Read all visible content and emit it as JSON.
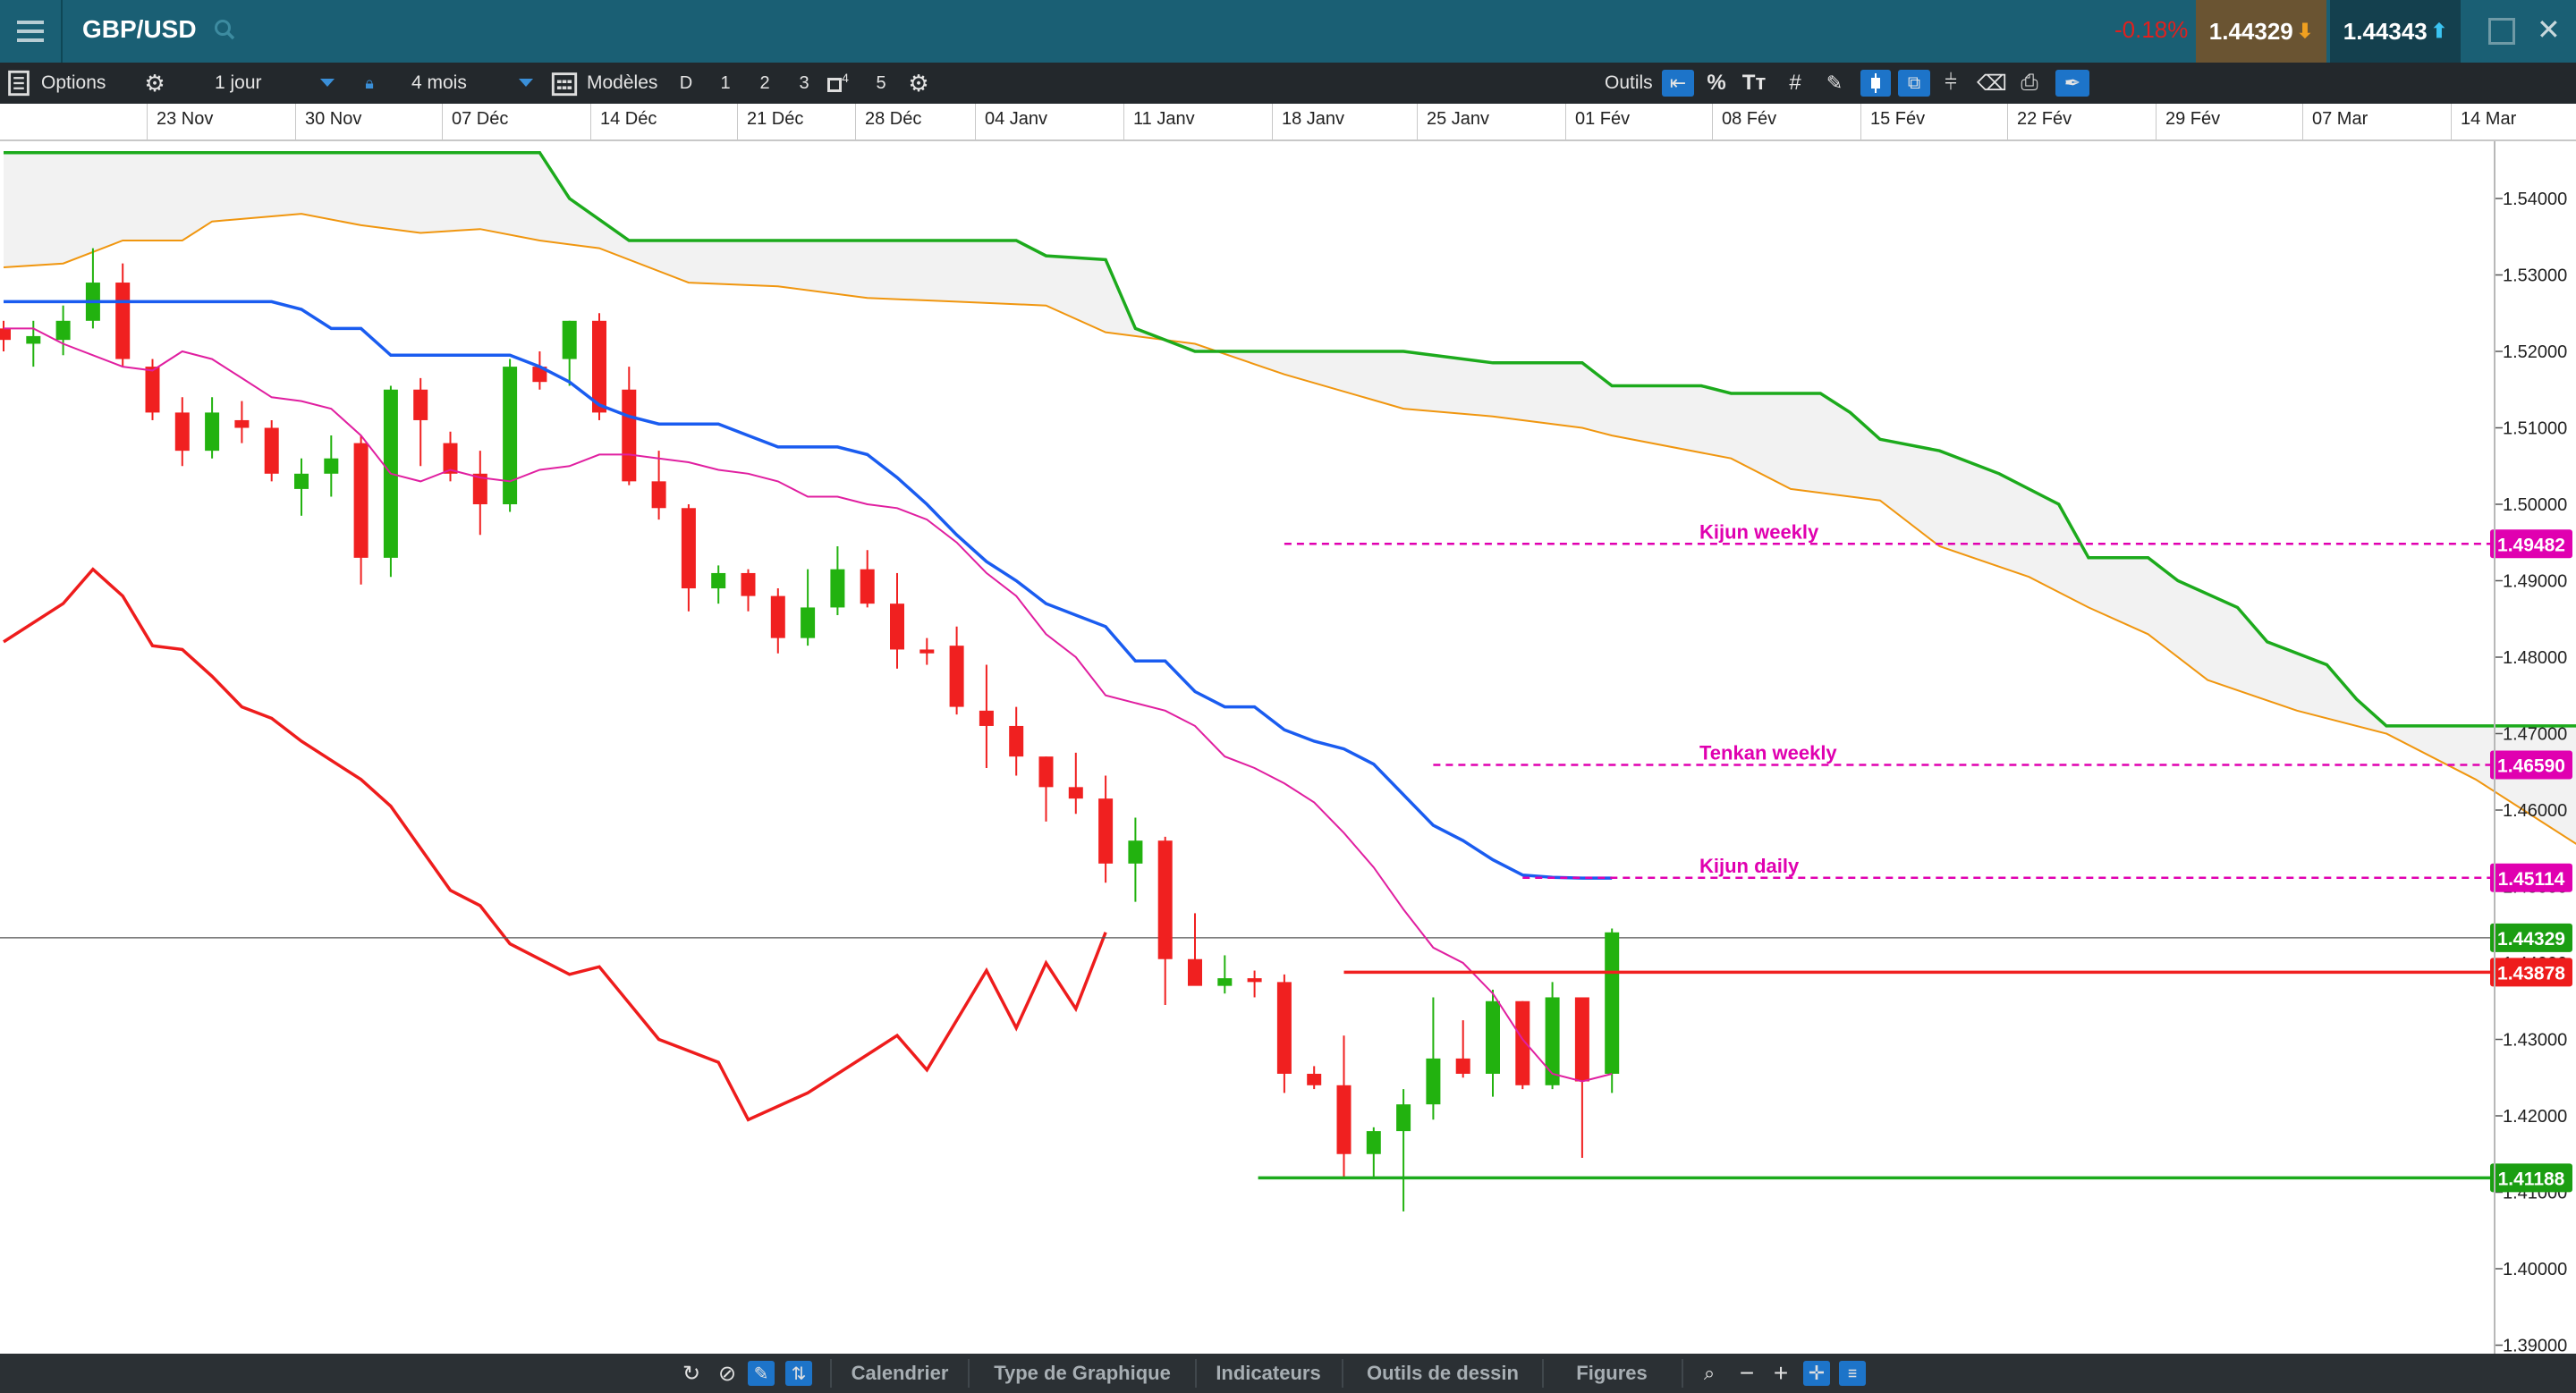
{
  "header": {
    "instrument": "GBP/USD",
    "change": "-0.18%",
    "bid": "1.44329",
    "ask": "1.44343"
  },
  "toolbar": {
    "options_label": "Options",
    "interval": "1 jour",
    "period": "4 mois",
    "models_label": "Modèles",
    "model_buttons": [
      "D",
      "1",
      "2",
      "3",
      "4",
      "5"
    ],
    "tools_label": "Outils"
  },
  "bottom_bar": {
    "tabs": [
      "Calendrier",
      "Type de Graphique",
      "Indicateurs",
      "Outils de dessin",
      "Figures"
    ]
  },
  "colors": {
    "header_bg": "#1a5f74",
    "toolbar_bg": "#23282c",
    "bullish": "#22b20f",
    "bearish": "#f02020",
    "kijun": "#1a5cf0",
    "tenkan": "#e01fa0",
    "senkou_b": "#1caa1c",
    "senkou_a": "#f0960f",
    "chikou": "#ee1c1c",
    "level_line": "#e000b0"
  },
  "chart_data": {
    "type": "candlestick",
    "x_axis_type": "date",
    "date_ticks": [
      "23 Nov",
      "30 Nov",
      "07 Déc",
      "14 Déc",
      "21 Déc",
      "28 Déc",
      "04 Janv",
      "11 Janv",
      "18 Janv",
      "25 Janv",
      "01 Fév",
      "08 Fév",
      "15 Fév",
      "22 Fév",
      "29 Fév",
      "07 Mar",
      "14 Mar"
    ],
    "price_ticks": [
      "1.54000",
      "1.53000",
      "1.52000",
      "1.51000",
      "1.50000",
      "1.49000",
      "1.48000",
      "1.47000",
      "1.46000",
      "1.45000",
      "1.44000",
      "1.43000",
      "1.42000",
      "1.41000",
      "1.40000",
      "1.39000"
    ],
    "ylim": [
      1.3895,
      1.5475
    ],
    "grid": false,
    "candles": [
      [
        1.523,
        1.524,
        1.52,
        1.5215
      ],
      [
        1.521,
        1.524,
        1.518,
        1.522
      ],
      [
        1.5215,
        1.526,
        1.5195,
        1.524
      ],
      [
        1.524,
        1.5335,
        1.523,
        1.529
      ],
      [
        1.529,
        1.5315,
        1.518,
        1.519
      ],
      [
        1.518,
        1.519,
        1.511,
        1.512
      ],
      [
        1.512,
        1.514,
        1.505,
        1.507
      ],
      [
        1.507,
        1.514,
        1.506,
        1.512
      ],
      [
        1.511,
        1.5135,
        1.508,
        1.51
      ],
      [
        1.51,
        1.511,
        1.503,
        1.504
      ],
      [
        1.502,
        1.506,
        1.4985,
        1.504
      ],
      [
        1.504,
        1.509,
        1.501,
        1.506
      ],
      [
        1.508,
        1.509,
        1.4895,
        1.493
      ],
      [
        1.493,
        1.5155,
        1.4905,
        1.515
      ],
      [
        1.515,
        1.5165,
        1.505,
        1.511
      ],
      [
        1.508,
        1.5095,
        1.503,
        1.504
      ],
      [
        1.504,
        1.507,
        1.496,
        1.5
      ],
      [
        1.5,
        1.519,
        1.499,
        1.518
      ],
      [
        1.518,
        1.52,
        1.515,
        1.516
      ],
      [
        1.519,
        1.524,
        1.5155,
        1.524
      ],
      [
        1.524,
        1.525,
        1.511,
        1.512
      ],
      [
        1.515,
        1.518,
        1.5025,
        1.503
      ],
      [
        1.503,
        1.507,
        1.498,
        1.4995
      ],
      [
        1.4995,
        1.5,
        1.486,
        1.489
      ],
      [
        1.489,
        1.492,
        1.487,
        1.491
      ],
      [
        1.491,
        1.4915,
        1.486,
        1.488
      ],
      [
        1.488,
        1.489,
        1.4805,
        1.4825
      ],
      [
        1.4825,
        1.4915,
        1.4815,
        1.4865
      ],
      [
        1.4865,
        1.4945,
        1.4855,
        1.4915
      ],
      [
        1.4915,
        1.494,
        1.4865,
        1.487
      ],
      [
        1.487,
        1.491,
        1.4785,
        1.481
      ],
      [
        1.481,
        1.4825,
        1.479,
        1.4805
      ],
      [
        1.4815,
        1.484,
        1.4725,
        1.4735
      ],
      [
        1.473,
        1.479,
        1.4655,
        1.471
      ],
      [
        1.471,
        1.4735,
        1.4645,
        1.467
      ],
      [
        1.467,
        1.467,
        1.4585,
        1.463
      ],
      [
        1.463,
        1.4675,
        1.4595,
        1.4615
      ],
      [
        1.4615,
        1.4645,
        1.4505,
        1.453
      ],
      [
        1.453,
        1.459,
        1.448,
        1.456
      ],
      [
        1.456,
        1.4565,
        1.4345,
        1.4405
      ],
      [
        1.4405,
        1.4465,
        1.4385,
        1.437
      ],
      [
        1.437,
        1.441,
        1.436,
        1.438
      ],
      [
        1.438,
        1.439,
        1.4355,
        1.4375
      ],
      [
        1.4375,
        1.4385,
        1.423,
        1.4255
      ],
      [
        1.4255,
        1.4265,
        1.4235,
        1.424
      ],
      [
        1.424,
        1.4305,
        1.412,
        1.415
      ],
      [
        1.415,
        1.4185,
        1.412,
        1.418
      ],
      [
        1.418,
        1.4235,
        1.4075,
        1.4215
      ],
      [
        1.4215,
        1.4355,
        1.4195,
        1.4275
      ],
      [
        1.4275,
        1.4325,
        1.425,
        1.4255
      ],
      [
        1.4255,
        1.4365,
        1.4225,
        1.435
      ],
      [
        1.435,
        1.435,
        1.4235,
        1.424
      ],
      [
        1.424,
        1.4375,
        1.4235,
        1.4355
      ],
      [
        1.4355,
        1.4345,
        1.4145,
        1.4245
      ],
      [
        1.4255,
        1.4445,
        1.423,
        1.444
      ]
    ],
    "kijun_daily": [
      1.5265,
      1.5265,
      1.5265,
      1.5265,
      1.5265,
      1.5265,
      1.5265,
      1.5265,
      1.5265,
      1.5265,
      1.5255,
      1.523,
      1.523,
      1.5195,
      1.5195,
      1.5195,
      1.5195,
      1.5195,
      1.518,
      1.516,
      1.513,
      1.5115,
      1.5105,
      1.5105,
      1.5105,
      1.509,
      1.5075,
      1.5075,
      1.5075,
      1.5065,
      1.5035,
      1.5,
      1.496,
      1.4925,
      1.49,
      1.487,
      1.4855,
      1.484,
      1.4795,
      1.4795,
      1.4755,
      1.4735,
      1.4735,
      1.4705,
      1.469,
      1.468,
      1.466,
      1.462,
      1.458,
      1.456,
      1.4535,
      1.4515,
      1.4512,
      1.4511,
      1.4511
    ],
    "tenkan_daily": [
      1.523,
      1.523,
      1.521,
      1.5195,
      1.518,
      1.5175,
      1.52,
      1.519,
      1.5165,
      1.514,
      1.5135,
      1.5125,
      1.509,
      1.504,
      1.503,
      1.5045,
      1.5035,
      1.503,
      1.5045,
      1.505,
      1.5065,
      1.5065,
      1.506,
      1.5055,
      1.5045,
      1.504,
      1.503,
      1.501,
      1.501,
      1.5,
      1.4995,
      1.498,
      1.495,
      1.491,
      1.488,
      1.483,
      1.48,
      1.475,
      1.474,
      1.473,
      1.471,
      1.467,
      1.4655,
      1.4635,
      1.461,
      1.457,
      1.4525,
      1.447,
      1.442,
      1.44,
      1.436,
      1.43,
      1.4255,
      1.4245,
      1.4255
    ],
    "chikou": [
      [
        0,
        1.482
      ],
      [
        2,
        1.487
      ],
      [
        3,
        1.4915
      ],
      [
        4,
        1.488
      ],
      [
        5,
        1.4815
      ],
      [
        6,
        1.481
      ],
      [
        7,
        1.4775
      ],
      [
        8,
        1.4735
      ],
      [
        9,
        1.472
      ],
      [
        10,
        1.469
      ],
      [
        12,
        1.464
      ],
      [
        13,
        1.4605
      ],
      [
        15,
        1.4495
      ],
      [
        16,
        1.4475
      ],
      [
        17,
        1.4425
      ],
      [
        19,
        1.4385
      ],
      [
        20,
        1.4395
      ],
      [
        22,
        1.43
      ],
      [
        24,
        1.427
      ],
      [
        25,
        1.4195
      ],
      [
        27,
        1.423
      ],
      [
        29,
        1.428
      ],
      [
        30,
        1.4305
      ],
      [
        31,
        1.426
      ],
      [
        32,
        1.4325
      ],
      [
        33,
        1.439
      ],
      [
        34,
        1.4315
      ],
      [
        35,
        1.44
      ],
      [
        36,
        1.434
      ],
      [
        37,
        1.444
      ]
    ],
    "senkou_a_cloud": [
      [
        0,
        1.531
      ],
      [
        2,
        1.5315
      ],
      [
        4,
        1.5345
      ],
      [
        6,
        1.5345
      ],
      [
        7,
        1.537
      ],
      [
        10,
        1.538
      ],
      [
        12,
        1.5365
      ],
      [
        14,
        1.5355
      ],
      [
        16,
        1.536
      ],
      [
        18,
        1.5345
      ],
      [
        20,
        1.5335
      ],
      [
        23,
        1.529
      ],
      [
        26,
        1.5285
      ],
      [
        29,
        1.527
      ],
      [
        32,
        1.5265
      ],
      [
        35,
        1.526
      ],
      [
        37,
        1.5225
      ],
      [
        40,
        1.521
      ],
      [
        43,
        1.517
      ],
      [
        47,
        1.5125
      ],
      [
        50,
        1.5115
      ],
      [
        53,
        1.51
      ],
      [
        54,
        1.509
      ],
      [
        58,
        1.506
      ],
      [
        60,
        1.502
      ],
      [
        63,
        1.5005
      ],
      [
        65,
        1.4945
      ],
      [
        68,
        1.4905
      ],
      [
        70,
        1.4865
      ],
      [
        72,
        1.483
      ],
      [
        74,
        1.477
      ],
      [
        77,
        1.473
      ],
      [
        80,
        1.47
      ],
      [
        83,
        1.464
      ],
      [
        85,
        1.459
      ],
      [
        87,
        1.454
      ],
      [
        89,
        1.452
      ],
      [
        91,
        1.45
      ],
      [
        93,
        1.4465
      ],
      [
        95,
        1.441
      ],
      [
        98,
        1.4386
      ],
      [
        100,
        1.4388
      ],
      [
        101,
        1.439
      ]
    ],
    "senkou_b_cloud": [
      [
        0,
        1.546
      ],
      [
        4,
        1.546
      ],
      [
        8,
        1.546
      ],
      [
        12,
        1.546
      ],
      [
        16,
        1.546
      ],
      [
        18,
        1.546
      ],
      [
        19,
        1.54
      ],
      [
        21,
        1.5345
      ],
      [
        26,
        1.5345
      ],
      [
        30,
        1.5345
      ],
      [
        34,
        1.5345
      ],
      [
        35,
        1.5325
      ],
      [
        37,
        1.532
      ],
      [
        38,
        1.523
      ],
      [
        40,
        1.52
      ],
      [
        44,
        1.52
      ],
      [
        47,
        1.52
      ],
      [
        50,
        1.5185
      ],
      [
        53,
        1.5185
      ],
      [
        54,
        1.5155
      ],
      [
        57,
        1.5155
      ],
      [
        58,
        1.5145
      ],
      [
        61,
        1.5145
      ],
      [
        62,
        1.512
      ],
      [
        63,
        1.5085
      ],
      [
        65,
        1.507
      ],
      [
        67,
        1.504
      ],
      [
        69,
        1.5
      ],
      [
        70,
        1.493
      ],
      [
        72,
        1.493
      ],
      [
        73,
        1.49
      ],
      [
        75,
        1.4865
      ],
      [
        76,
        1.482
      ],
      [
        78,
        1.479
      ],
      [
        79,
        1.4745
      ],
      [
        80,
        1.471
      ],
      [
        83,
        1.471
      ],
      [
        86,
        1.471
      ],
      [
        89,
        1.471
      ],
      [
        92,
        1.471
      ],
      [
        95,
        1.471
      ],
      [
        98,
        1.471
      ],
      [
        101,
        1.471
      ]
    ],
    "levels": [
      {
        "name": "Kijun weekly",
        "value": 1.49482,
        "label": "1.49482",
        "style": "dashed",
        "start": 43
      },
      {
        "name": "Tenkan weekly",
        "value": 1.4659,
        "label": "1.46590",
        "style": "dashed",
        "start": 48
      },
      {
        "name": "Kijun daily",
        "value": 1.45114,
        "label": "1.45114",
        "style": "dashed",
        "start": 51
      },
      {
        "value": 1.44329,
        "label": "1.44329",
        "style": "current"
      },
      {
        "value": 1.43878,
        "label": "1.43878",
        "style": "resistance",
        "start": 45
      },
      {
        "value": 1.41188,
        "label": "1.41188",
        "style": "support",
        "start": 42
      }
    ]
  }
}
